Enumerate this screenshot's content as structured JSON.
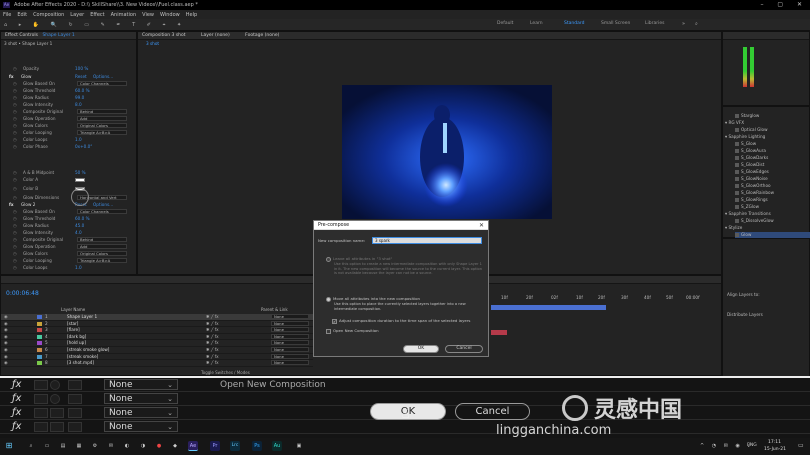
{
  "window": {
    "title": "Adobe After Effects 2020 - D:\\\\ SkillShare\\\\3. New Videos\\\\Fuel.class.aep *"
  },
  "menu": [
    "File",
    "Edit",
    "Composition",
    "Layer",
    "Effect",
    "Animation",
    "View",
    "Window",
    "Help"
  ],
  "workspaces": [
    "Default",
    "Learn",
    "Standard",
    "Small Screen",
    "Libraries"
  ],
  "active_workspace": "Standard",
  "effect_controls": {
    "tab": "Effect Controls",
    "layer": "Shape Layer 1",
    "path": "3 shot • Shape Layer 1",
    "rows": [
      {
        "name": "Opacity",
        "val": "100 %"
      },
      {
        "fx": "Glow",
        "reset": "Reset",
        "options": "Options..."
      },
      {
        "name": "Glow Based On",
        "dd": "Color Channels"
      },
      {
        "name": "Glow Threshold",
        "val": "60.0 %"
      },
      {
        "name": "Glow Radius",
        "val": "99.0"
      },
      {
        "name": "Glow Intensity",
        "val": "8.0"
      },
      {
        "name": "Composite Original",
        "dd": "Behind"
      },
      {
        "name": "Glow Operation",
        "dd": "Add"
      },
      {
        "name": "Glow Colors",
        "dd": "Original Colors"
      },
      {
        "name": "Color Looping",
        "dd": "Triangle A>B>A"
      },
      {
        "name": "Color Loops",
        "val": "1.0"
      },
      {
        "name": "Color Phase",
        "val": "0x+0.0°"
      },
      {
        "name": "A & B Midpoint",
        "val": "50 %"
      },
      {
        "name": "Color A",
        "val": ""
      },
      {
        "name": "Color B",
        "val": ""
      },
      {
        "name": "Glow Dimensions",
        "dd": "Horizontal and Vert"
      },
      {
        "fx": "Glow 2",
        "reset": "Reset",
        "options": "Options..."
      },
      {
        "name": "Glow Based On",
        "dd": "Color Channels"
      },
      {
        "name": "Glow Threshold",
        "val": "60.0 %"
      },
      {
        "name": "Glow Radius",
        "val": "45.0"
      },
      {
        "name": "Glow Intensity",
        "val": "4.0"
      },
      {
        "name": "Composite Original",
        "dd": "Behind"
      },
      {
        "name": "Glow Operation",
        "dd": "Add"
      },
      {
        "name": "Glow Colors",
        "dd": "Original Colors"
      },
      {
        "name": "Color Looping",
        "dd": "Triangle A>B>A"
      },
      {
        "name": "Color Loops",
        "val": "1.0"
      }
    ]
  },
  "composition": {
    "tab": "Composition 3 shot",
    "sub": "3 shot",
    "layer_tab": "Layer (none)",
    "footage_tab": "Footage (none)"
  },
  "project": {
    "items": [
      {
        "type": "item",
        "label": "Starglow"
      },
      {
        "type": "folder",
        "label": "RG VFX"
      },
      {
        "type": "item",
        "label": "Optical Glow"
      },
      {
        "type": "folder",
        "label": "Sapphire Lighting"
      },
      {
        "type": "item",
        "label": "S_Glow"
      },
      {
        "type": "item",
        "label": "S_GlowAura"
      },
      {
        "type": "item",
        "label": "S_GlowDarks"
      },
      {
        "type": "item",
        "label": "S_GlowDist"
      },
      {
        "type": "item",
        "label": "S_GlowEdges"
      },
      {
        "type": "item",
        "label": "S_GlowNoise"
      },
      {
        "type": "item",
        "label": "S_GlowOrthoo"
      },
      {
        "type": "item",
        "label": "S_GlowRainbow"
      },
      {
        "type": "item",
        "label": "S_GlowRings"
      },
      {
        "type": "item",
        "label": "S_ZGlow"
      },
      {
        "type": "folder",
        "label": "Sapphire Transitions"
      },
      {
        "type": "item",
        "label": "S_DissolveGlow"
      },
      {
        "type": "folder",
        "label": "Stylize"
      },
      {
        "type": "item",
        "label": "Glow"
      }
    ],
    "align_label": "Align Layers to:",
    "distribute_label": "Distribute Layers"
  },
  "timeline": {
    "timecode": "0:00:06:48",
    "layer_header": "Layer Name",
    "parent_header": "Parent & Link",
    "toggle_label": "Toggle Switches / Modes",
    "ruler": [
      "10f",
      "20f",
      "02f",
      "10f",
      "20f",
      "30f",
      "40f",
      "50f",
      "00:00f"
    ],
    "layers": [
      {
        "num": "1",
        "name": "Shape Layer 1",
        "mode": "None",
        "color": "#4a6fd1"
      },
      {
        "num": "2",
        "name": "[star]",
        "mode": "None",
        "color": "#c9a43a"
      },
      {
        "num": "3",
        "name": "[flare]",
        "mode": "None",
        "color": "#c94a4a"
      },
      {
        "num": "4",
        "name": "[dark bg]",
        "mode": "None",
        "color": "#4ac9a0"
      },
      {
        "num": "5",
        "name": "[hold up]",
        "mode": "None",
        "color": "#9a4ac9"
      },
      {
        "num": "6",
        "name": "[streak smoke glow]",
        "mode": "None",
        "color": "#c98a4a"
      },
      {
        "num": "7",
        "name": "[streak smoke]",
        "mode": "None",
        "color": "#4a9ac9"
      },
      {
        "num": "8",
        "name": "[3 shot.mp4]",
        "mode": "None",
        "color": "#7ac94a"
      }
    ]
  },
  "dialog": {
    "title": "Pre-compose",
    "name_label": "New composition name:",
    "name_value": "3 spark",
    "opt1_title": "Leave all attributes in \"3 shot\"",
    "opt1_desc": "Use this option to create a new intermediate composition with only Shape Layer 1 in it. The new composition will become the source to the current layer. This option is not available because the layer can not be a source.",
    "opt2_title": "Move all attributes into the new composition",
    "opt2_desc": "Use this option to place the currently selected layers together into a new intermediate composition.",
    "adjust_label": "Adjust composition duration to the time span of the selected layers",
    "open_label": "Open New Composition",
    "ok": "OK",
    "cancel": "Cancel"
  },
  "zoom": {
    "modes": [
      "None",
      "None",
      "None",
      "None"
    ],
    "open_label": "Open New Composition",
    "ok": "OK",
    "cancel": "Cancel"
  },
  "taskbar": {
    "time": "17:11",
    "date": "15-Jun-21",
    "lang": "ENG",
    "apps": [
      "Ae",
      "Pr",
      "Lrc",
      "Ps",
      "Au"
    ]
  },
  "watermark": {
    "text": "灵感中国",
    "url": "lingganchina.com"
  }
}
